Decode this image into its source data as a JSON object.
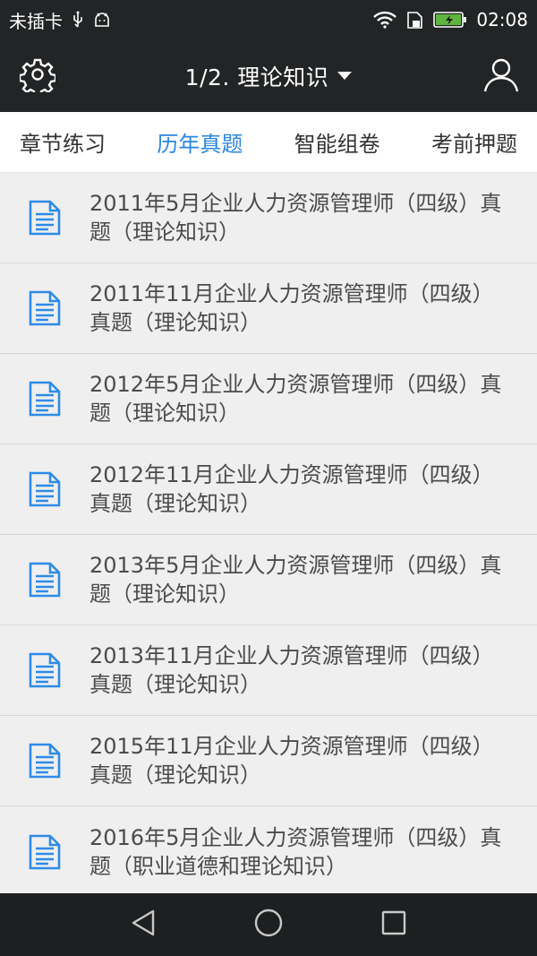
{
  "status_bar": {
    "carrier": "未插卡",
    "time": "02:08"
  },
  "app_bar": {
    "title": "1/2. 理论知识"
  },
  "tabs": [
    {
      "label": "章节练习",
      "active": false
    },
    {
      "label": "历年真题",
      "active": true
    },
    {
      "label": "智能组卷",
      "active": false
    },
    {
      "label": "考前押题",
      "active": false
    }
  ],
  "items": [
    {
      "title": "2011年5月企业人力资源管理师（四级）真题（理论知识）"
    },
    {
      "title": "2011年11月企业人力资源管理师（四级）真题（理论知识）"
    },
    {
      "title": "2012年5月企业人力资源管理师（四级）真题（理论知识）"
    },
    {
      "title": "2012年11月企业人力资源管理师（四级）真题（理论知识）"
    },
    {
      "title": "2013年5月企业人力资源管理师（四级）真题（理论知识）"
    },
    {
      "title": "2013年11月企业人力资源管理师（四级）真题（理论知识）"
    },
    {
      "title": "2015年11月企业人力资源管理师（四级）真题（理论知识）"
    },
    {
      "title": "2016年5月企业人力资源管理师（四级）真题（职业道德和理论知识）"
    }
  ],
  "colors": {
    "accent": "#2a86e2",
    "bar": "#222425",
    "document_icon": "#2d8be8"
  },
  "icons": {
    "settings": "gear-icon",
    "account": "user-icon",
    "document": "document-icon",
    "back": "back-triangle-icon",
    "home": "home-circle-icon",
    "recents": "recents-square-icon"
  }
}
